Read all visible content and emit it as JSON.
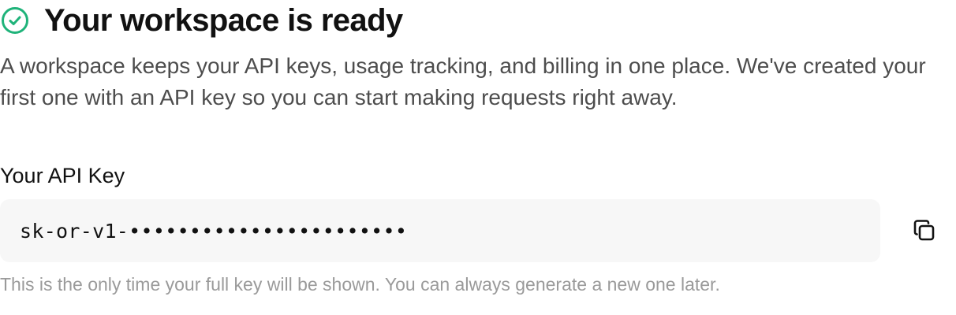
{
  "header": {
    "title": "Your workspace is ready",
    "icon": "check-circle-icon",
    "icon_color": "#1fb37a"
  },
  "description": "A workspace keeps your API keys, usage tracking, and billing in one place. We've created your first one with an API key so you can start making requests right away.",
  "api_key": {
    "label": "Your API Key",
    "value": "sk-or-v1-•••••••••••••••••••••••",
    "copy_icon": "copy-icon"
  },
  "hint": "This is the only time your full key will be shown. You can always generate a new one later."
}
